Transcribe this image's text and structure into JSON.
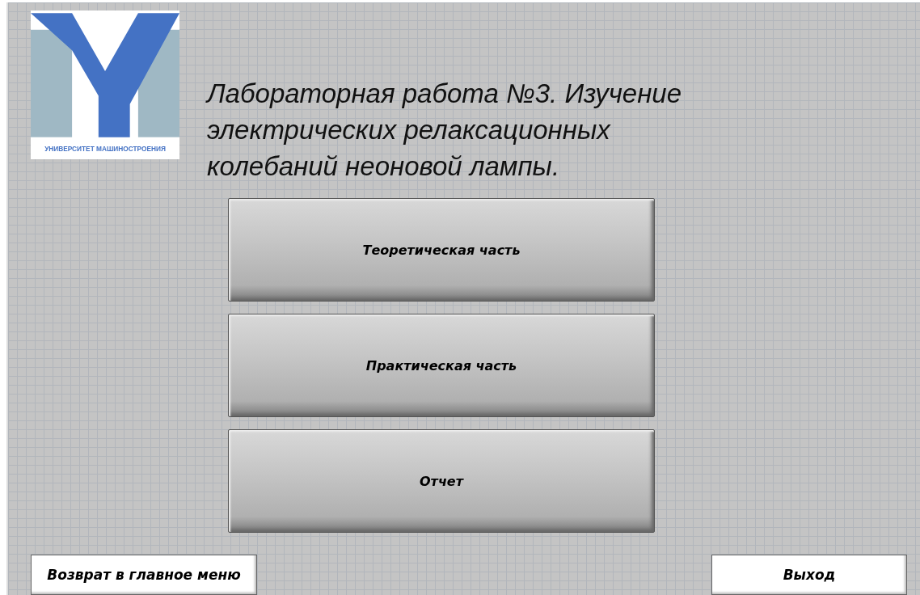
{
  "logo": {
    "caption": "УНИВЕРСИТЕТ МАШИНОСТРОЕНИЯ"
  },
  "title": "Лабораторная работа №3. Изучение электрических релаксационных колебаний неоновой лампы.",
  "menu_buttons": [
    {
      "label": "Теоретическая часть"
    },
    {
      "label": "Практическая часть"
    },
    {
      "label": "Отчет"
    }
  ],
  "footer_buttons": [
    {
      "label": "Возврат в главное меню"
    },
    {
      "label": "Выход"
    }
  ]
}
